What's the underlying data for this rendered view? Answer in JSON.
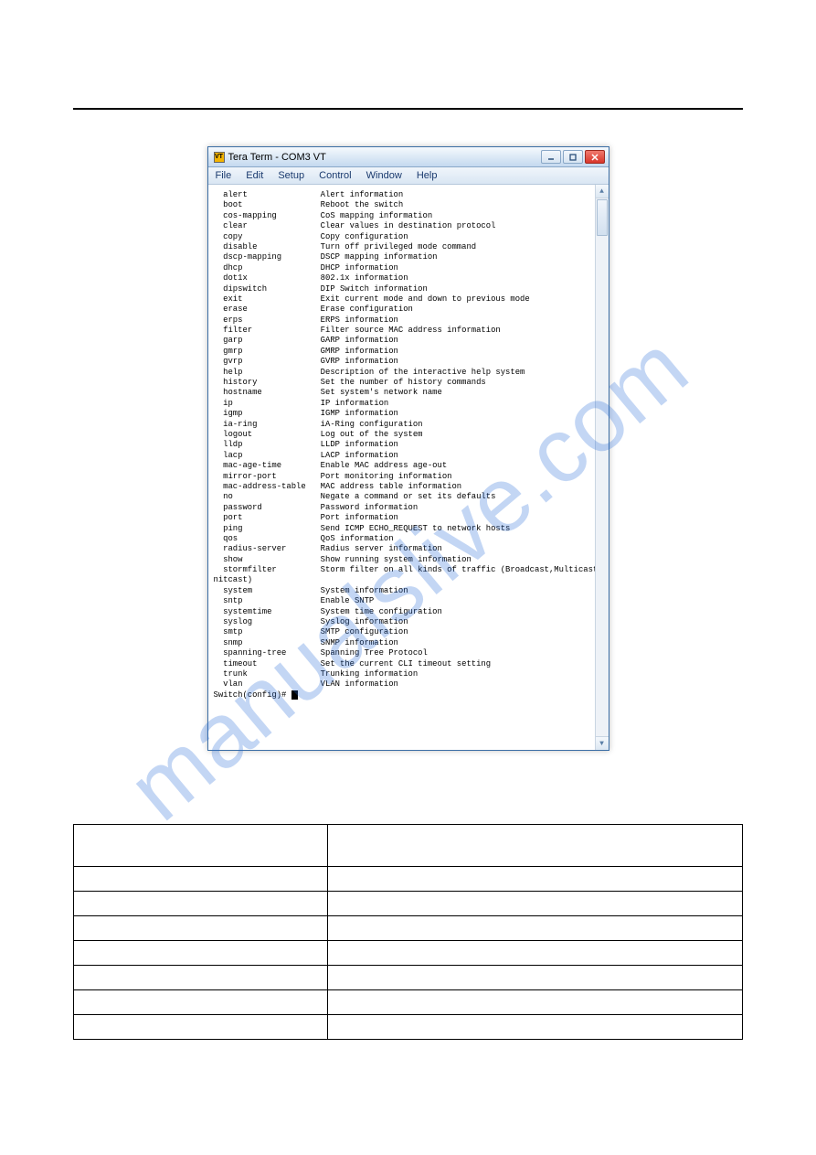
{
  "watermark": "manualslive.com",
  "window": {
    "icon_text": "VT",
    "title": "Tera Term - COM3 VT",
    "menu": [
      "File",
      "Edit",
      "Setup",
      "Control",
      "Window",
      "Help"
    ]
  },
  "terminal": {
    "commands": [
      {
        "cmd": "alert",
        "desc": "Alert information"
      },
      {
        "cmd": "boot",
        "desc": "Reboot the switch"
      },
      {
        "cmd": "cos-mapping",
        "desc": "CoS mapping information"
      },
      {
        "cmd": "clear",
        "desc": "Clear values in destination protocol"
      },
      {
        "cmd": "copy",
        "desc": "Copy configuration"
      },
      {
        "cmd": "disable",
        "desc": "Turn off privileged mode command"
      },
      {
        "cmd": "dscp-mapping",
        "desc": "DSCP mapping information"
      },
      {
        "cmd": "dhcp",
        "desc": "DHCP information"
      },
      {
        "cmd": "dot1x",
        "desc": "802.1x information"
      },
      {
        "cmd": "dipswitch",
        "desc": "DIP Switch information"
      },
      {
        "cmd": "exit",
        "desc": "Exit current mode and down to previous mode"
      },
      {
        "cmd": "erase",
        "desc": "Erase configuration"
      },
      {
        "cmd": "erps",
        "desc": "ERPS information"
      },
      {
        "cmd": "filter",
        "desc": "Filter source MAC address information"
      },
      {
        "cmd": "garp",
        "desc": "GARP information"
      },
      {
        "cmd": "gmrp",
        "desc": "GMRP information"
      },
      {
        "cmd": "gvrp",
        "desc": "GVRP information"
      },
      {
        "cmd": "help",
        "desc": "Description of the interactive help system"
      },
      {
        "cmd": "history",
        "desc": "Set the number of history commands"
      },
      {
        "cmd": "hostname",
        "desc": "Set system's network name"
      },
      {
        "cmd": "ip",
        "desc": "IP information"
      },
      {
        "cmd": "igmp",
        "desc": "IGMP information"
      },
      {
        "cmd": "ia-ring",
        "desc": "iA-Ring configuration"
      },
      {
        "cmd": "logout",
        "desc": "Log out of the system"
      },
      {
        "cmd": "lldp",
        "desc": "LLDP information"
      },
      {
        "cmd": "lacp",
        "desc": "LACP information"
      },
      {
        "cmd": "mac-age-time",
        "desc": "Enable MAC address age-out"
      },
      {
        "cmd": "mirror-port",
        "desc": "Port monitoring information"
      },
      {
        "cmd": "mac-address-table",
        "desc": "MAC address table information"
      },
      {
        "cmd": "no",
        "desc": "Negate a command or set its defaults"
      },
      {
        "cmd": "password",
        "desc": "Password information"
      },
      {
        "cmd": "port",
        "desc": "Port information"
      },
      {
        "cmd": "ping",
        "desc": "Send ICMP ECHO_REQUEST to network hosts"
      },
      {
        "cmd": "qos",
        "desc": "QoS information"
      },
      {
        "cmd": "radius-server",
        "desc": "Radius server information"
      },
      {
        "cmd": "show",
        "desc": "Show running system information"
      },
      {
        "cmd": "stormfilter",
        "desc": "Storm filter on all kinds of traffic (Broadcast,Multicast,U"
      }
    ],
    "wrap_line": "nitcast)",
    "commands2": [
      {
        "cmd": "system",
        "desc": "System information"
      },
      {
        "cmd": "sntp",
        "desc": "Enable SNTP"
      },
      {
        "cmd": "systemtime",
        "desc": "System time configuration"
      },
      {
        "cmd": "syslog",
        "desc": "Syslog information"
      },
      {
        "cmd": "smtp",
        "desc": "SMTP configuration"
      },
      {
        "cmd": "snmp",
        "desc": "SNMP information"
      },
      {
        "cmd": "spanning-tree",
        "desc": "Spanning Tree Protocol"
      },
      {
        "cmd": "timeout",
        "desc": "Set the current CLI timeout setting"
      },
      {
        "cmd": "trunk",
        "desc": "Trunking information"
      },
      {
        "cmd": "vlan",
        "desc": "VLAN information"
      }
    ],
    "prompt": "Switch(config)# "
  },
  "table": {
    "rows": [
      [
        "",
        ""
      ],
      [
        "",
        ""
      ],
      [
        "",
        ""
      ],
      [
        "",
        ""
      ],
      [
        "",
        ""
      ],
      [
        "",
        ""
      ],
      [
        "",
        ""
      ]
    ]
  }
}
